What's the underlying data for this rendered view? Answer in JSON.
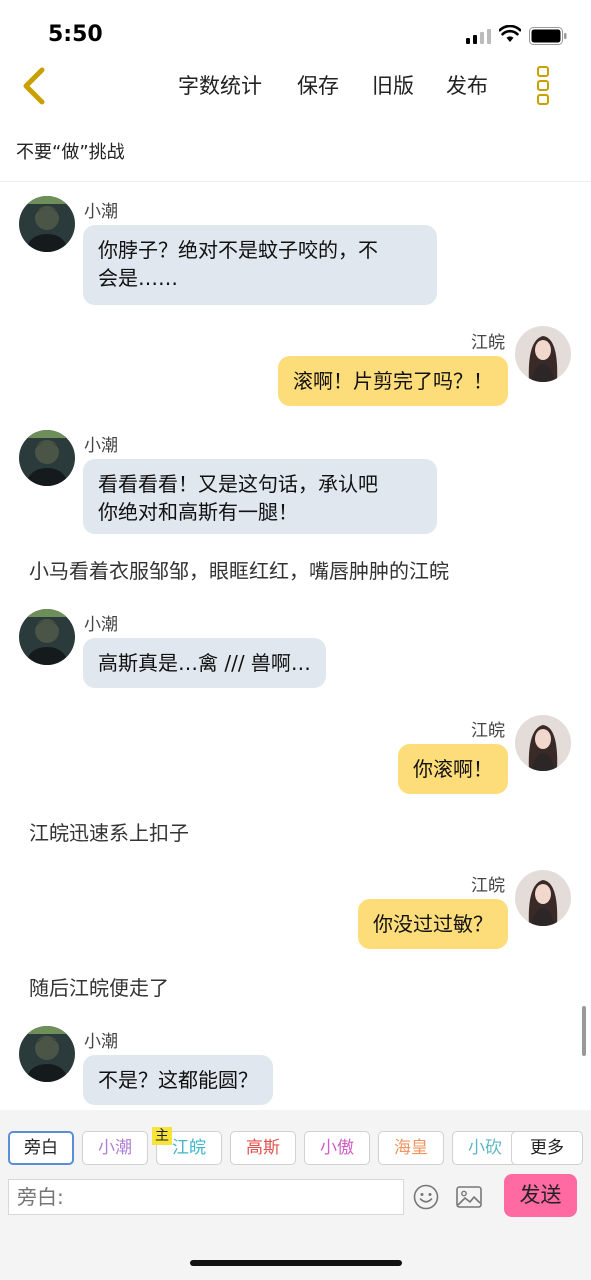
{
  "status": {
    "time": "5:50"
  },
  "nav": {
    "word_count": "字数统计",
    "save": "保存",
    "old_version": "旧版",
    "publish": "发布"
  },
  "chapter_title": "不要“做”挑战",
  "messages": [
    {
      "type": "chat",
      "side": "left",
      "name": "小潮",
      "text": "你脖子？绝对不是蚊子咬的，不\n会是……"
    },
    {
      "type": "chat",
      "side": "right",
      "name": "江皖",
      "text": "滚啊！片剪完了吗？！"
    },
    {
      "type": "chat",
      "side": "left",
      "name": "小潮",
      "text": "看看看看！又是这句话，承认吧\n你绝对和高斯有一腿！"
    },
    {
      "type": "narration",
      "text": "小马看着衣服邹邹，眼眶红红，嘴唇肿肿的江皖"
    },
    {
      "type": "chat",
      "side": "left",
      "name": "小潮",
      "text": "高斯真是…禽 /// 兽啊…"
    },
    {
      "type": "chat",
      "side": "right",
      "name": "江皖",
      "text": "你滚啊！"
    },
    {
      "type": "narration",
      "text": "江皖迅速系上扣子"
    },
    {
      "type": "chat",
      "side": "right",
      "name": "江皖",
      "text": "你没过过敏？"
    },
    {
      "type": "narration",
      "text": "随后江皖便走了"
    },
    {
      "type": "chat",
      "side": "left",
      "name": "小潮",
      "text": "不是？这都能圆？"
    }
  ],
  "roles": [
    {
      "label": "旁白",
      "color": "#222222",
      "active": true
    },
    {
      "label": "小潮",
      "color": "#b07fd6",
      "active": false
    },
    {
      "label": "江皖",
      "color": "#3fb6c9",
      "active": false,
      "badge": "主"
    },
    {
      "label": "高斯",
      "color": "#e0524f",
      "active": false
    },
    {
      "label": "小傲",
      "color": "#cf5ec7",
      "active": false
    },
    {
      "label": "海皇",
      "color": "#f09560",
      "active": false
    },
    {
      "label": "小砍",
      "color": "#5fb6c6",
      "active": false
    }
  ],
  "more_label": "更多",
  "input": {
    "placeholder": "旁白:"
  },
  "send_label": "发送",
  "icons": {
    "back": "chevron-left-icon",
    "more": "more-vertical-icon",
    "emoji": "emoji-icon",
    "image": "image-icon"
  },
  "colors": {
    "accent": "#c9a000",
    "bubble_left": "#e0e7ef",
    "bubble_right": "#fddc7a",
    "send": "#ff6aa3"
  }
}
